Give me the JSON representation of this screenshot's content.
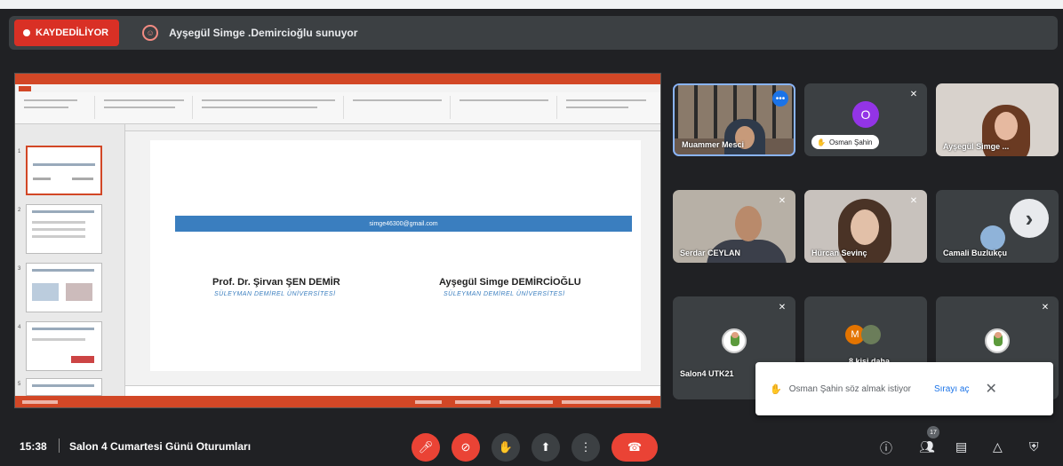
{
  "topbar": {
    "recording_label": "KAYDEDİLİYOR",
    "presenting_text": "Ayşegül Simge .Demircioğlu sunuyor"
  },
  "presentation": {
    "email": "simge46300@gmail.com",
    "author1_name": "Prof. Dr. Şirvan ŞEN DEMİR",
    "author1_univ": "SÜLEYMAN DEMİREL ÜNİVERSİTESİ",
    "author2_name": "Ayşegül Simge DEMİRCİOĞLU",
    "author2_univ": "SÜLEYMAN DEMİREL ÜNİVERSİTESİ",
    "slide_numbers": [
      "1",
      "2",
      "3",
      "4",
      "5"
    ]
  },
  "participants": {
    "tile1": "Muammer Mesci",
    "tile2": "Osman Şahin",
    "tile2_initial": "O",
    "tile3": "Ayşegül Simge ...",
    "tile4": "Serdar CEYLAN",
    "tile5": "Hürcan Sevinç",
    "tile6": "Camali Buzlukçu",
    "tile7": "Salon4 UTK21",
    "tile8_initial": "M",
    "tile8": "8 kişi daha"
  },
  "toast": {
    "message": "Osman Şahin söz almak istiyor",
    "action": "Sırayı aç",
    "close": "✕"
  },
  "bottom": {
    "time": "15:38",
    "meeting_name": "Salon 4 Cumartesi Günü Oturumları",
    "people_count": "17"
  },
  "icons": {
    "mic_off": "mic-off-icon",
    "camera_off": "camera-off-icon",
    "hand": "raise-hand-icon",
    "present": "present-icon",
    "more": "more-options-icon",
    "end_call": "end-call-icon",
    "info": "info-icon",
    "people": "people-icon",
    "chat": "chat-icon",
    "activities": "activities-icon",
    "host": "host-controls-icon"
  },
  "colors": {
    "recording": "#d93025",
    "end_call": "#ea4335",
    "accent": "#1a73e8",
    "slide_band": "#3a7ebf",
    "powerpoint": "#d24726"
  }
}
